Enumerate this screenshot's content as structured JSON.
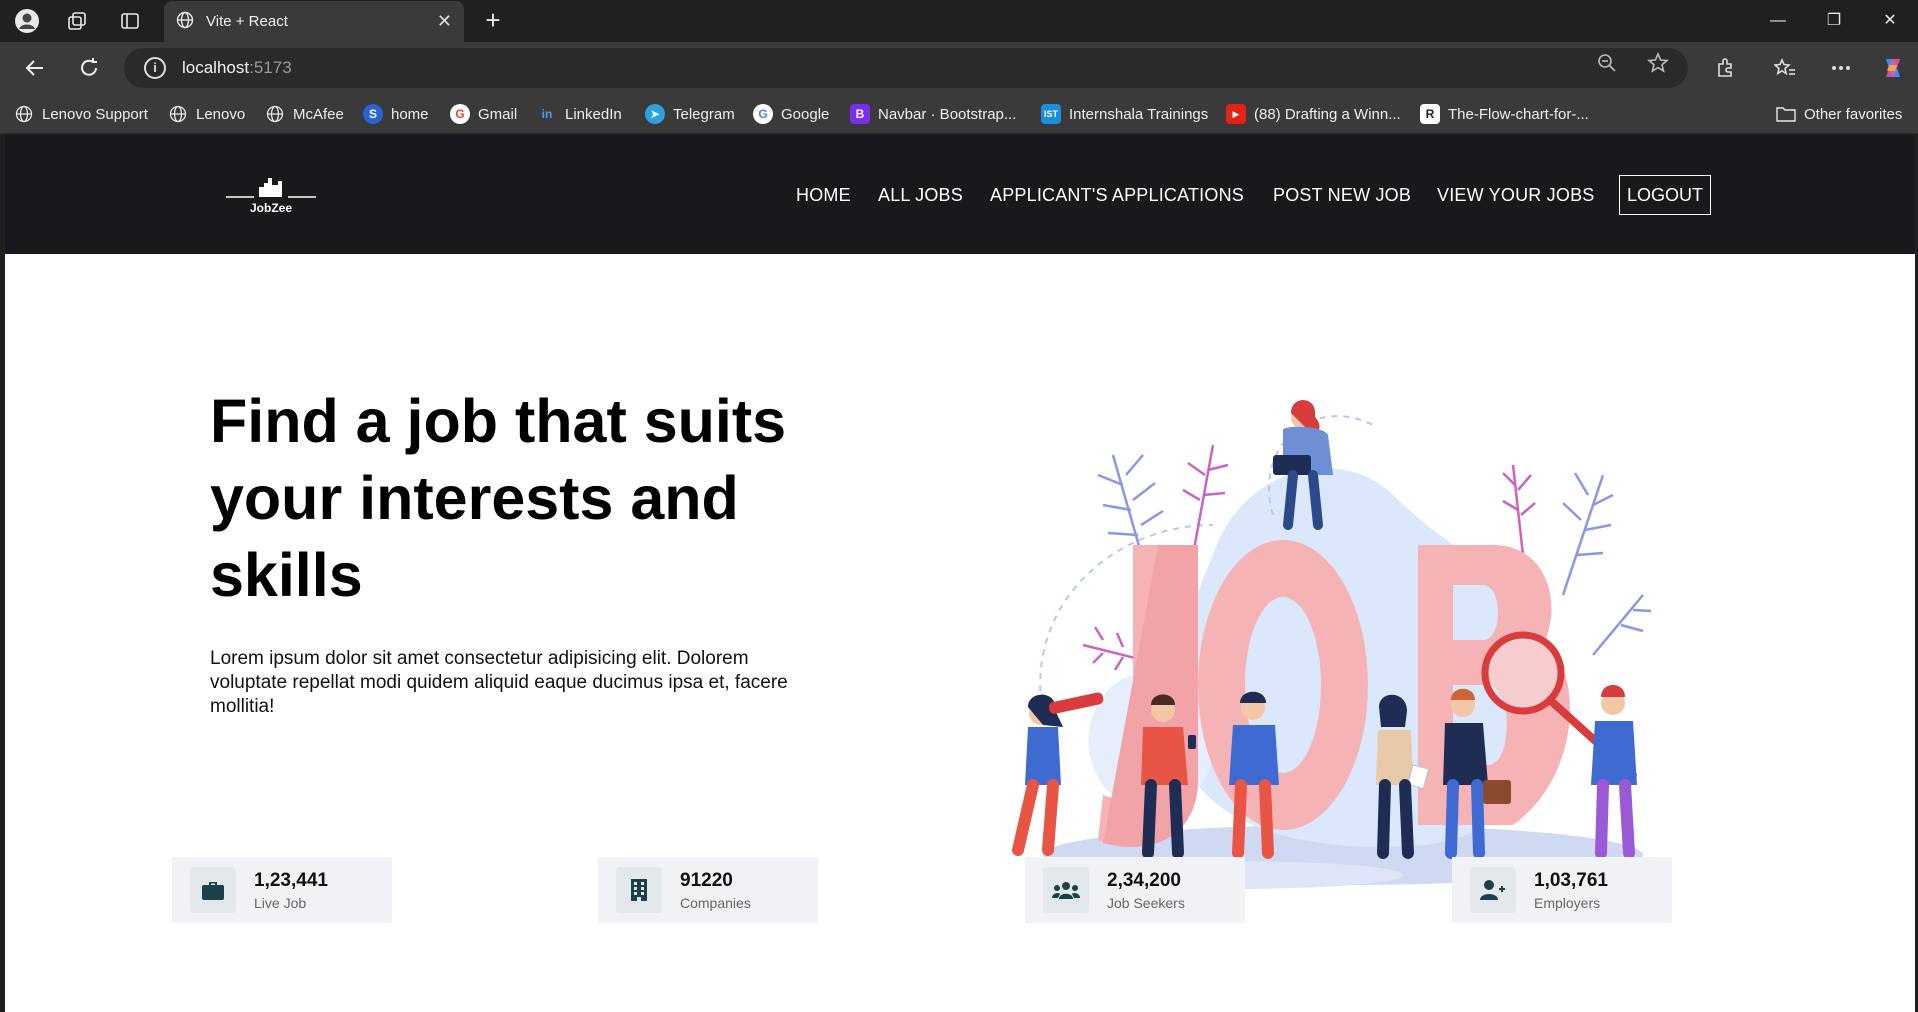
{
  "browser": {
    "tab_title": "Vite + React",
    "url_host": "localhost",
    "url_port": ":5173",
    "bookmarks": [
      {
        "label": "Lenovo Support",
        "icon": "globe-icon"
      },
      {
        "label": "Lenovo",
        "icon": "globe-icon"
      },
      {
        "label": "McAfee",
        "icon": "globe-icon"
      },
      {
        "label": "home",
        "icon": "home-icon"
      },
      {
        "label": "Gmail",
        "icon": "google-icon"
      },
      {
        "label": "LinkedIn",
        "icon": "linkedin-icon"
      },
      {
        "label": "Telegram",
        "icon": "telegram-icon"
      },
      {
        "label": "Google",
        "icon": "google-icon"
      },
      {
        "label": "Navbar · Bootstrap...",
        "icon": "bootstrap-icon"
      },
      {
        "label": "Internshala Trainings",
        "icon": "internshala-icon"
      },
      {
        "label": "(88) Drafting a Winn...",
        "icon": "youtube-icon"
      },
      {
        "label": "The-Flow-chart-for-...",
        "icon": "r-icon"
      }
    ],
    "other_favorites": "Other favorites"
  },
  "site": {
    "logo_text": "JobZee",
    "nav": {
      "home": "HOME",
      "all_jobs": "ALL JOBS",
      "applications": "APPLICANT'S APPLICATIONS",
      "post_job": "POST NEW JOB",
      "view_jobs": "VIEW YOUR JOBS",
      "logout": "LOGOUT"
    },
    "hero": {
      "title": "Find a job that suits your interests and skills",
      "text": "Lorem ipsum dolor sit amet consectetur adipisicing elit. Dolorem voluptate repellat modi quidem aliquid eaque ducimus ipsa et, facere mollitia!",
      "illustration_letters": "JOB"
    },
    "stats": [
      {
        "value": "1,23,441",
        "label": "Live Job",
        "icon": "briefcase-icon"
      },
      {
        "value": "91220",
        "label": "Companies",
        "icon": "building-icon"
      },
      {
        "value": "2,34,200",
        "label": "Job Seekers",
        "icon": "users-icon"
      },
      {
        "value": "1,03,761",
        "label": "Employers",
        "icon": "user-plus-icon"
      }
    ]
  }
}
